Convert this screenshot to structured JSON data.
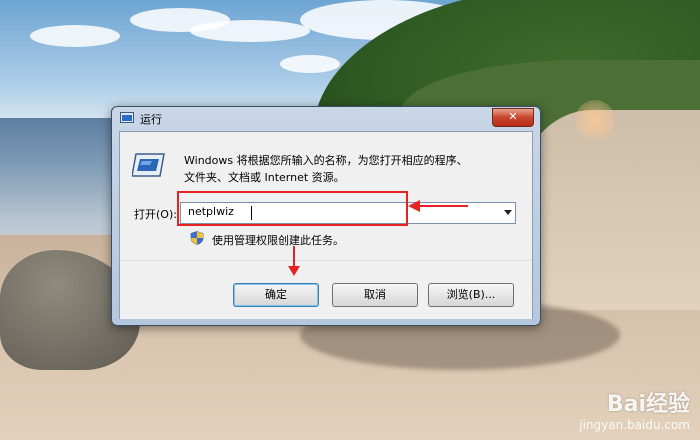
{
  "window": {
    "title": "运行",
    "close_label": "✕"
  },
  "dialog": {
    "description_line1": "Windows 将根据您所输入的名称，为您打开相应的程序、",
    "description_line2": "文件夹、文档或 Internet 资源。",
    "open_label": "打开(O):",
    "input_value": "netplwiz",
    "admin_note": "使用管理权限创建此任务。"
  },
  "buttons": {
    "ok": "确定",
    "cancel": "取消",
    "browse": "浏览(B)..."
  },
  "watermark": {
    "logo": "Bai经验",
    "url": "jingyan.baidu.com"
  },
  "icons": [
    "run-icon",
    "run-program-icon",
    "dropdown-arrow-icon",
    "uac-shield-icon",
    "close-icon"
  ],
  "colors": {
    "annotation": "#e62222",
    "close_button": "#c7452c"
  }
}
